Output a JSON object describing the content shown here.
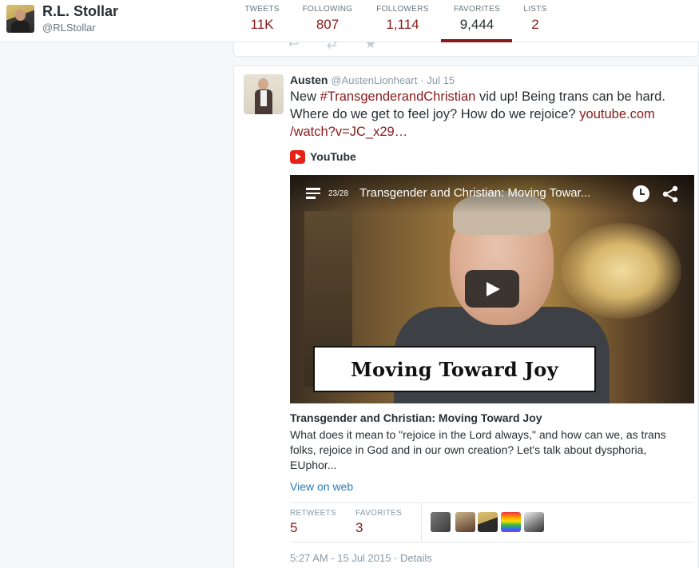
{
  "profile": {
    "name": "R.L. Stollar",
    "handle": "@RLStollar"
  },
  "stats": [
    {
      "label": "TWEETS",
      "value": "11K"
    },
    {
      "label": "FOLLOWING",
      "value": "807"
    },
    {
      "label": "FOLLOWERS",
      "value": "1,114"
    },
    {
      "label": "FAVORITES",
      "value": "9,444"
    },
    {
      "label": "LISTS",
      "value": "2"
    }
  ],
  "tweet": {
    "name": "Austen",
    "handle": "@AustenLionheart",
    "dot": "·",
    "date": "Jul 15",
    "text_before": "New ",
    "hashtag": "#TransgenderandChristian",
    "text_after": " vid up! Being trans can be hard. Where do we get to feel joy? How do we rejoice? ",
    "link": "youtube.com /watch?v=JC_x29…",
    "source": "YouTube",
    "video": {
      "playlist_count": "23/28",
      "title": "Transgender and Christian: Moving Towar...",
      "banner_text": "Moving Toward Joy"
    },
    "card_title": "Transgender and Christian: Moving Toward Joy",
    "card_description": "What does it mean to \"rejoice in the Lord always,\" and how can we, as trans folks, rejoice in God and in our own creation? Let's talk about dysphoria, EUphor...",
    "view_on_web": "View on web",
    "retweets_label": "RETWEETS",
    "retweets": "5",
    "favorites_label": "FAVORITES",
    "favorites": "3",
    "timestamp": "5:27 AM - 15 Jul 2015",
    "timestamp_sep": " · ",
    "details": "Details"
  },
  "colors": {
    "accent": "#8b1a1a",
    "link_blue": "#2b7bb9",
    "muted": "#8899a6"
  }
}
